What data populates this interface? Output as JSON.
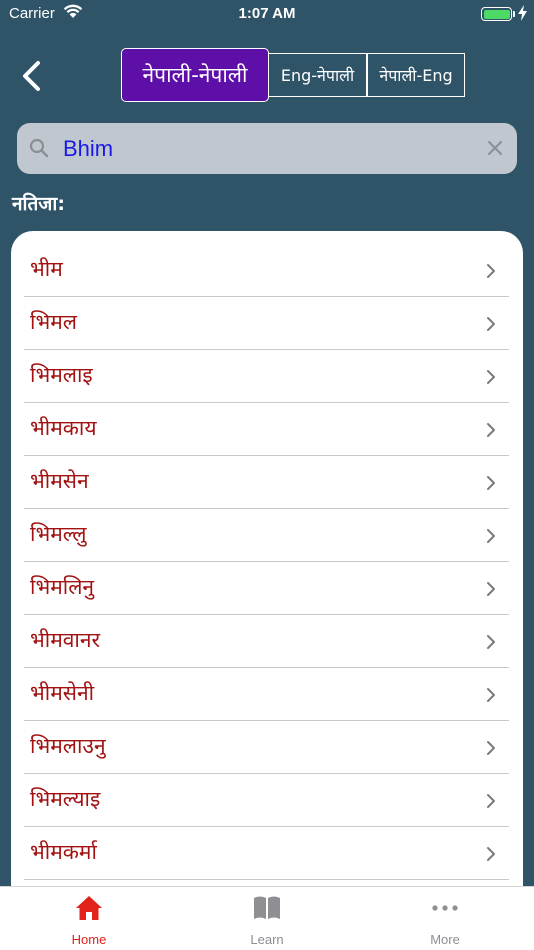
{
  "status_bar": {
    "carrier": "Carrier",
    "time": "1:07 AM",
    "battery_level": 1.0,
    "battery_color": "#4cd964"
  },
  "header": {
    "back_icon": "chevron-left-icon",
    "modes": [
      {
        "label": "नेपाली-नेपाली",
        "selected": true
      },
      {
        "label": "Eng-नेपाली",
        "selected": false
      },
      {
        "label": "नेपाली-Eng",
        "selected": false
      }
    ],
    "selected_color": "#5d0fa8"
  },
  "search": {
    "value": "Bhim",
    "icon": "search-icon",
    "clear_icon": "clear-icon"
  },
  "results_label": "नतिजा:",
  "results": [
    "भीम",
    "भिमल",
    "भिमलाइ",
    "भीमकाय",
    "भीमसेन",
    "भिमल्लु",
    "भिमलिनु",
    "भीमवानर",
    "भीमसेनी",
    "भिमलाउनु",
    "भिमल्याइ",
    "भीमकर्मा"
  ],
  "word_color": "#a31212",
  "tabs": [
    {
      "label": "Home",
      "icon": "home-icon",
      "active": true
    },
    {
      "label": "Learn",
      "icon": "book-icon",
      "active": false
    },
    {
      "label": "More",
      "icon": "more-icon",
      "active": false
    }
  ],
  "accent_color": "#e3211b",
  "background_color": "#2f5468"
}
